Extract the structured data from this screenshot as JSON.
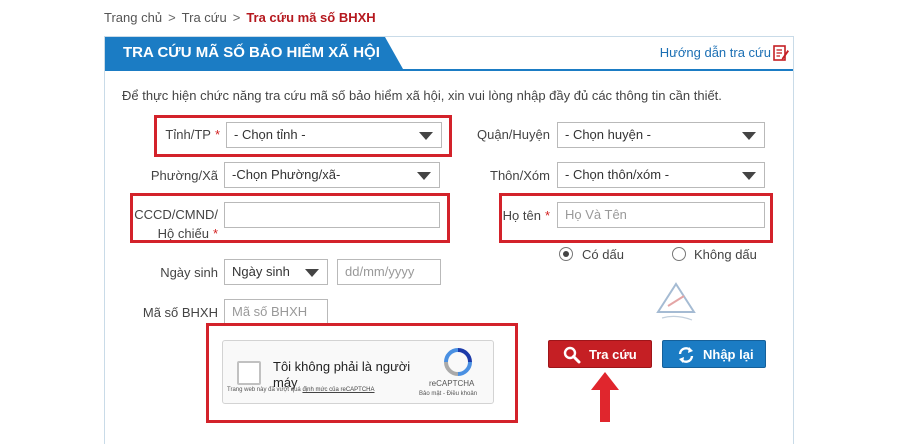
{
  "breadcrumb": {
    "home": "Trang chủ",
    "sep": ">",
    "lookup": "Tra cứu",
    "current": "Tra cứu mã số BHXH"
  },
  "panel": {
    "title": "TRA CỨU MÃ SỐ BẢO HIỂM XÃ HỘI",
    "guide_link": "Hướng dẫn tra cứu",
    "guide_icon": "edit-document-icon",
    "intro": "Để thực hiện chức năng tra cứu mã số bảo hiểm xã hội, xin vui lòng nhập đầy đủ các thông tin cần thiết."
  },
  "form": {
    "province": {
      "label": "Tỉnh/TP",
      "required_mark": "*",
      "value": "- Chọn tỉnh -"
    },
    "district": {
      "label": "Quận/Huyện",
      "value": "- Chọn huyện -"
    },
    "ward": {
      "label": "Phường/Xã",
      "value": "-Chọn Phường/xã-"
    },
    "hamlet": {
      "label": "Thôn/Xóm",
      "value": "- Chọn thôn/xóm -"
    },
    "id_card": {
      "label_line1": "CCCD/CMND/",
      "label_line2": "Hộ chiếu",
      "required_mark": "*",
      "value": ""
    },
    "full_name": {
      "label": "Họ tên",
      "required_mark": "*",
      "placeholder": "Họ Và Tên"
    },
    "accent_options": [
      {
        "label": "Có dấu",
        "selected": true
      },
      {
        "label": "Không dấu",
        "selected": false
      }
    ],
    "birth_date": {
      "label": "Ngày sinh",
      "type_value": "Ngày sinh",
      "placeholder": "dd/mm/yyyy"
    },
    "bhxh_code": {
      "label": "Mã số BHXH",
      "placeholder": "Mã số BHXH"
    }
  },
  "captcha": {
    "checkbox_label": "Tôi không phải là người máy",
    "brand": "reCAPTCHA",
    "terms": "Bảo mật - Điều khoản",
    "note_prefix": "Trang web này đã vượt quá",
    "note_link": "định mức của reCAPTCHA"
  },
  "buttons": {
    "search": "Tra cứu",
    "reset": "Nhập lại"
  },
  "colors": {
    "brand_blue": "#1b7cc4",
    "accent_red": "#c51f24",
    "highlight_red": "#d3222a"
  }
}
